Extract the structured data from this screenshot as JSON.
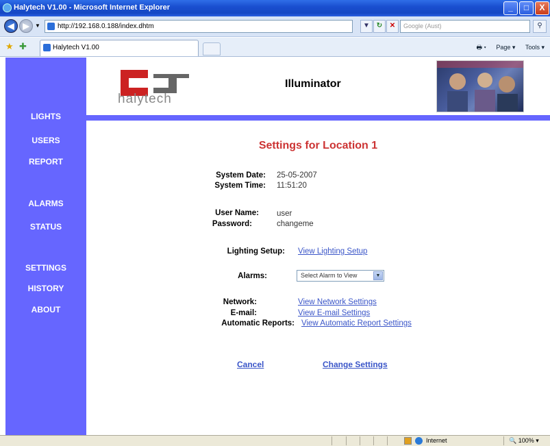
{
  "window": {
    "title": "Halytech V1.00 - Microsoft Internet Explorer",
    "controls": {
      "minimize": "_",
      "maximize": "□",
      "close": "X"
    }
  },
  "address_bar": {
    "url": "http://192.168.0.188/index.dhtm",
    "search_placeholder": "Google (Aust)"
  },
  "tab": {
    "title": "Halytech V1.00"
  },
  "toolbar": {
    "page": "Page",
    "tools": "Tools"
  },
  "sidebar": {
    "items": [
      "LIGHTS",
      "USERS",
      "REPORT",
      "ALARMS",
      "STATUS",
      "SETTINGS",
      "HISTORY",
      "ABOUT"
    ]
  },
  "header": {
    "logo_text": "halytech",
    "app_name": "Illuminator"
  },
  "content": {
    "heading": "Settings for Location 1",
    "system_date_label": "System Date:",
    "system_date": "25-05-2007",
    "system_time_label": "System Time:",
    "system_time": "11:51:20",
    "user_name_label": "User Name:",
    "user_name": "user",
    "password_label": "Password:",
    "password": "changeme",
    "lighting_setup_label": "Lighting Setup:",
    "lighting_setup_link": "View Lighting Setup",
    "alarms_label": "Alarms:",
    "alarms_select": "Select Alarm to View",
    "network_label": "Network:",
    "network_link": "View Network Settings",
    "email_label": "E-mail:",
    "email_link": "View E-mail Settings",
    "auto_reports_label": "Automatic Reports:",
    "auto_reports_link": "View Automatic Report Settings",
    "cancel": "Cancel",
    "change_settings": "Change Settings"
  },
  "statusbar": {
    "zone": "Internet",
    "zoom": "100%"
  },
  "colors": {
    "sidebar": "#6666ff",
    "heading": "#cc3333",
    "link": "#3a55c8"
  }
}
